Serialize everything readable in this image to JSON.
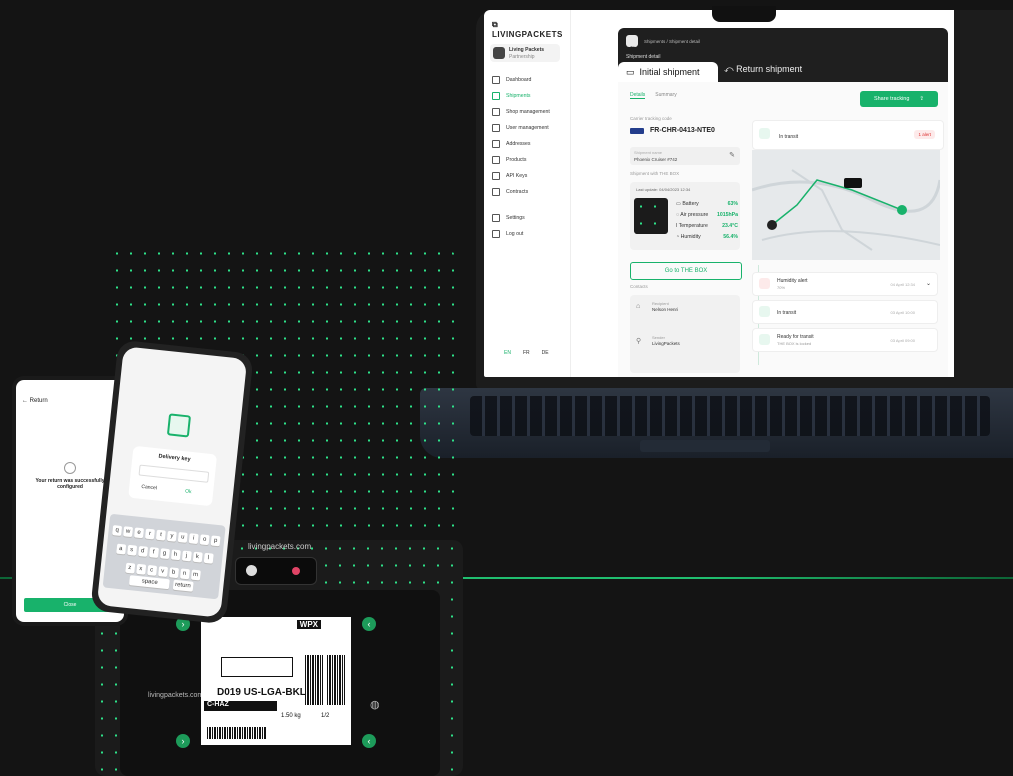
{
  "app": {
    "logo": "LIVINGPACKETS",
    "account_name": "Living Packets",
    "account_sub": "Partnership",
    "nav": [
      "Dashboard",
      "Shipments",
      "Shop management",
      "User management",
      "Addresses",
      "Products",
      "API Keys",
      "Contracts",
      "Settings",
      "Log out"
    ],
    "languages": [
      "EN",
      "FR",
      "DE"
    ]
  },
  "header": {
    "breadcrumb": "Shipments / Shipment detail",
    "section_label": "Shipment detail",
    "tab_initial": "Initial shipment",
    "tab_return": "Return shipment"
  },
  "main": {
    "subtabs": [
      "Details",
      "Summary"
    ],
    "share_button": "Share tracking",
    "carrier_label": "Carrier tracking code",
    "tracking_code": "FR-CHR-0413-NTE0",
    "shipment_name_label": "Shipment name",
    "shipment_name": "Phoenix Cruiser #742",
    "box_section_label": "Shipment with THE BOX",
    "last_update": "Last update: 04/04/2023 12:34",
    "metrics": [
      {
        "name": "Battery",
        "value": "63%"
      },
      {
        "name": "Air pressure",
        "value": "1015hPa"
      },
      {
        "name": "Temperature",
        "value": "23.4°C"
      },
      {
        "name": "Humidity",
        "value": "56.4%"
      }
    ],
    "go_button": "Go to THE BOX",
    "contacts_label": "Contacts",
    "recipient_label": "Recipient",
    "recipient": "Nelson Henri",
    "sender_label": "Sender",
    "sender": "LivingPackets",
    "status_label": "In transit",
    "status_badge": "1 alert"
  },
  "timeline": [
    {
      "title": "Humidity alert",
      "sub": "70%",
      "date": "04 April 12:34"
    },
    {
      "title": "In transit",
      "sub": "",
      "date": "03 April 10:00"
    },
    {
      "title": "Ready for transit",
      "sub": "THE BOX is locked",
      "date": "03 April 09:00"
    }
  ],
  "box": {
    "brand": "livingpackets.com",
    "label_code": "D019 US-LGA-BKL",
    "label_haz": "C-HAZ",
    "label_carrier": "WPX",
    "label_weight": "1.50 kg",
    "label_count": "1/2"
  },
  "phone_a": {
    "title": "Return",
    "message": "Your return was successfully configured",
    "button": "Close"
  },
  "phone_b": {
    "dialog_title": "Delivery key",
    "cancel": "Cancel",
    "ok": "Ok",
    "keyrows": [
      "qwertyuiop",
      "asdfghjkl",
      "zxcvbnm"
    ],
    "space": "space",
    "return": "return"
  },
  "colors": {
    "accent": "#18b26b",
    "background": "#141414"
  }
}
